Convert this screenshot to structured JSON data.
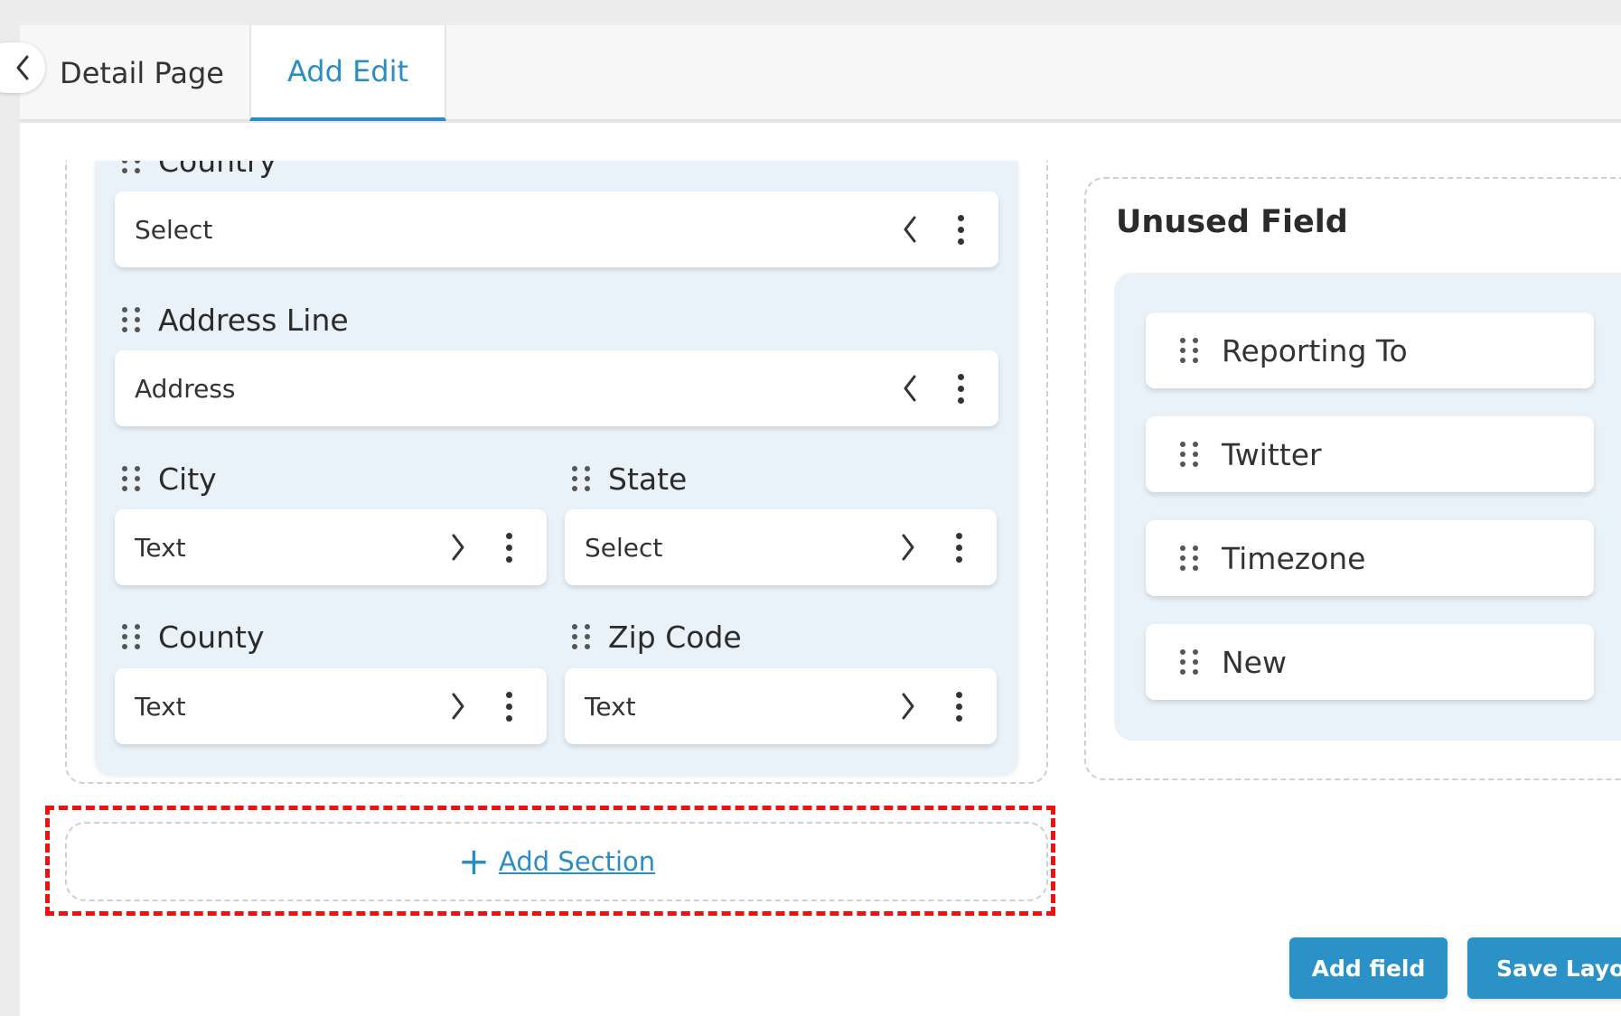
{
  "tabs": {
    "detail_label": "Detail Page",
    "edit_label": "Add Edit"
  },
  "section": {
    "fields": [
      {
        "label": "Country",
        "type": "Select"
      },
      {
        "label": "Address Line",
        "type": "Address"
      },
      {
        "label": "City",
        "type": "Text"
      },
      {
        "label": "State",
        "type": "Select"
      },
      {
        "label": "County",
        "type": "Text"
      },
      {
        "label": "Zip Code",
        "type": "Text"
      }
    ]
  },
  "unused": {
    "title": "Unused Field",
    "items": [
      "Reporting To",
      "Twitter",
      "Timezone",
      "New"
    ]
  },
  "add_section": {
    "label": "Add Section"
  },
  "buttons": {
    "add_field": "Add field",
    "save_layout": "Save Layout"
  },
  "colors": {
    "accent": "#2a8ec4",
    "highlight": "#ee1111",
    "section_bg": "#e9f2f8"
  }
}
